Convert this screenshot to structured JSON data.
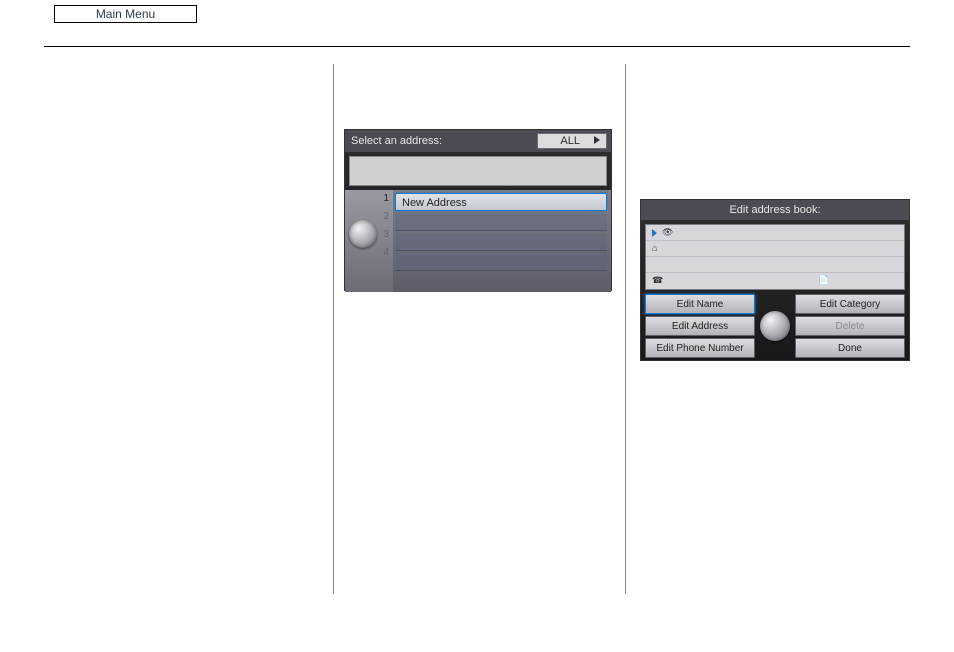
{
  "top_button": "Main Menu",
  "screen1": {
    "title": "Select an address:",
    "filter": "ALL",
    "rows": [
      "New Address",
      "",
      "",
      ""
    ],
    "nums": [
      "1",
      "2",
      "3",
      "4"
    ]
  },
  "screen2": {
    "title": "Edit address book:",
    "buttons": {
      "edit_name": "Edit Name",
      "edit_address": "Edit Address",
      "edit_phone": "Edit Phone Number",
      "edit_category": "Edit Category",
      "delete": "Delete",
      "done": "Done"
    }
  }
}
